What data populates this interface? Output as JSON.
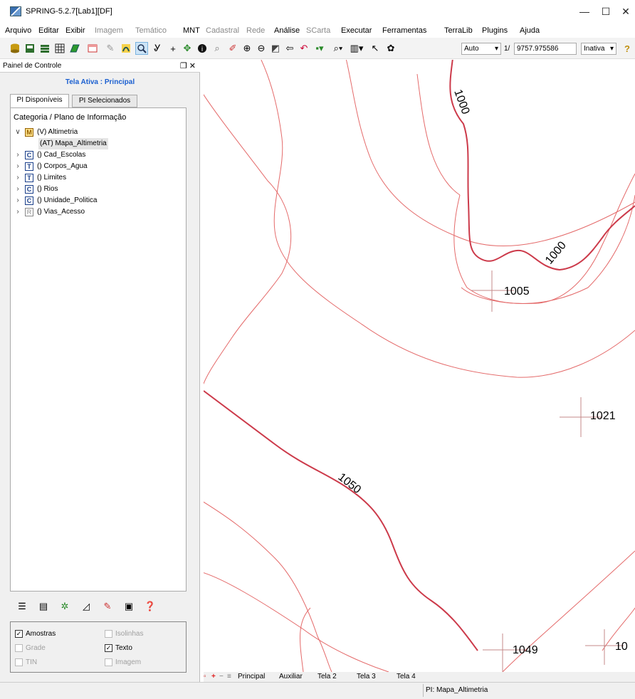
{
  "window": {
    "title": "SPRING-5.2.7[Lab1][DF]",
    "minimize": "—",
    "maximize": "☐",
    "close": "✕"
  },
  "menu": [
    {
      "label": "Arquivo",
      "enabled": true
    },
    {
      "label": "Editar",
      "enabled": true
    },
    {
      "label": "Exibir",
      "enabled": true
    },
    {
      "label": "Imagem",
      "enabled": false
    },
    {
      "label": "Temático",
      "enabled": false
    },
    {
      "label": "MNT",
      "enabled": true
    },
    {
      "label": "Cadastral",
      "enabled": false
    },
    {
      "label": "Rede",
      "enabled": false
    },
    {
      "label": "Análise",
      "enabled": true
    },
    {
      "label": "SCarta",
      "enabled": false
    },
    {
      "label": "Executar",
      "enabled": true
    },
    {
      "label": "Ferramentas",
      "enabled": true
    },
    {
      "label": "TerraLib",
      "enabled": true
    },
    {
      "label": "Plugins",
      "enabled": true
    },
    {
      "label": "Ajuda",
      "enabled": true
    }
  ],
  "toolbar": {
    "zoom_mode": "Auto",
    "scale_prefix": "1/",
    "scale_value": "9757.975586",
    "state": "Inativa"
  },
  "panel": {
    "title": "Painel de Controle",
    "tela_ativa": "Tela Ativa : Principal",
    "tabs": [
      "PI Disponíveis",
      "PI Selecionados"
    ],
    "tree_header": "Categoria / Plano de Informação",
    "categories": [
      {
        "badge": "M",
        "label": "(V) Altimetria",
        "expanded": true
      },
      {
        "badge": "C",
        "label": "() Cad_Escolas"
      },
      {
        "badge": "T",
        "label": "() Corpos_Agua"
      },
      {
        "badge": "T",
        "label": "() Limites"
      },
      {
        "badge": "C",
        "label": "() Rios"
      },
      {
        "badge": "C",
        "label": "() Unidade_Politica"
      },
      {
        "badge": "R",
        "label": "() Vias_Acesso"
      }
    ],
    "child": "(AT) Mapa_Altimetria",
    "options": [
      {
        "label": "Amostras",
        "checked": true,
        "enabled": true
      },
      {
        "label": "Isolinhas",
        "checked": false,
        "enabled": false
      },
      {
        "label": "Grade",
        "checked": false,
        "enabled": false
      },
      {
        "label": "Texto",
        "checked": true,
        "enabled": true
      },
      {
        "label": "TIN",
        "checked": false,
        "enabled": false
      },
      {
        "label": "Imagem",
        "checked": false,
        "enabled": false
      }
    ]
  },
  "map": {
    "contour_color": "#e04040",
    "contour_labels": [
      "1000",
      "1000",
      "1050"
    ],
    "point_labels": [
      "1005",
      "1021",
      "1049",
      "10"
    ]
  },
  "map_tabs": [
    "Principal",
    "Auxiliar",
    "Tela 2",
    "Tela 3",
    "Tela 4"
  ],
  "status": {
    "pi": "PI: Mapa_Altimetria"
  }
}
